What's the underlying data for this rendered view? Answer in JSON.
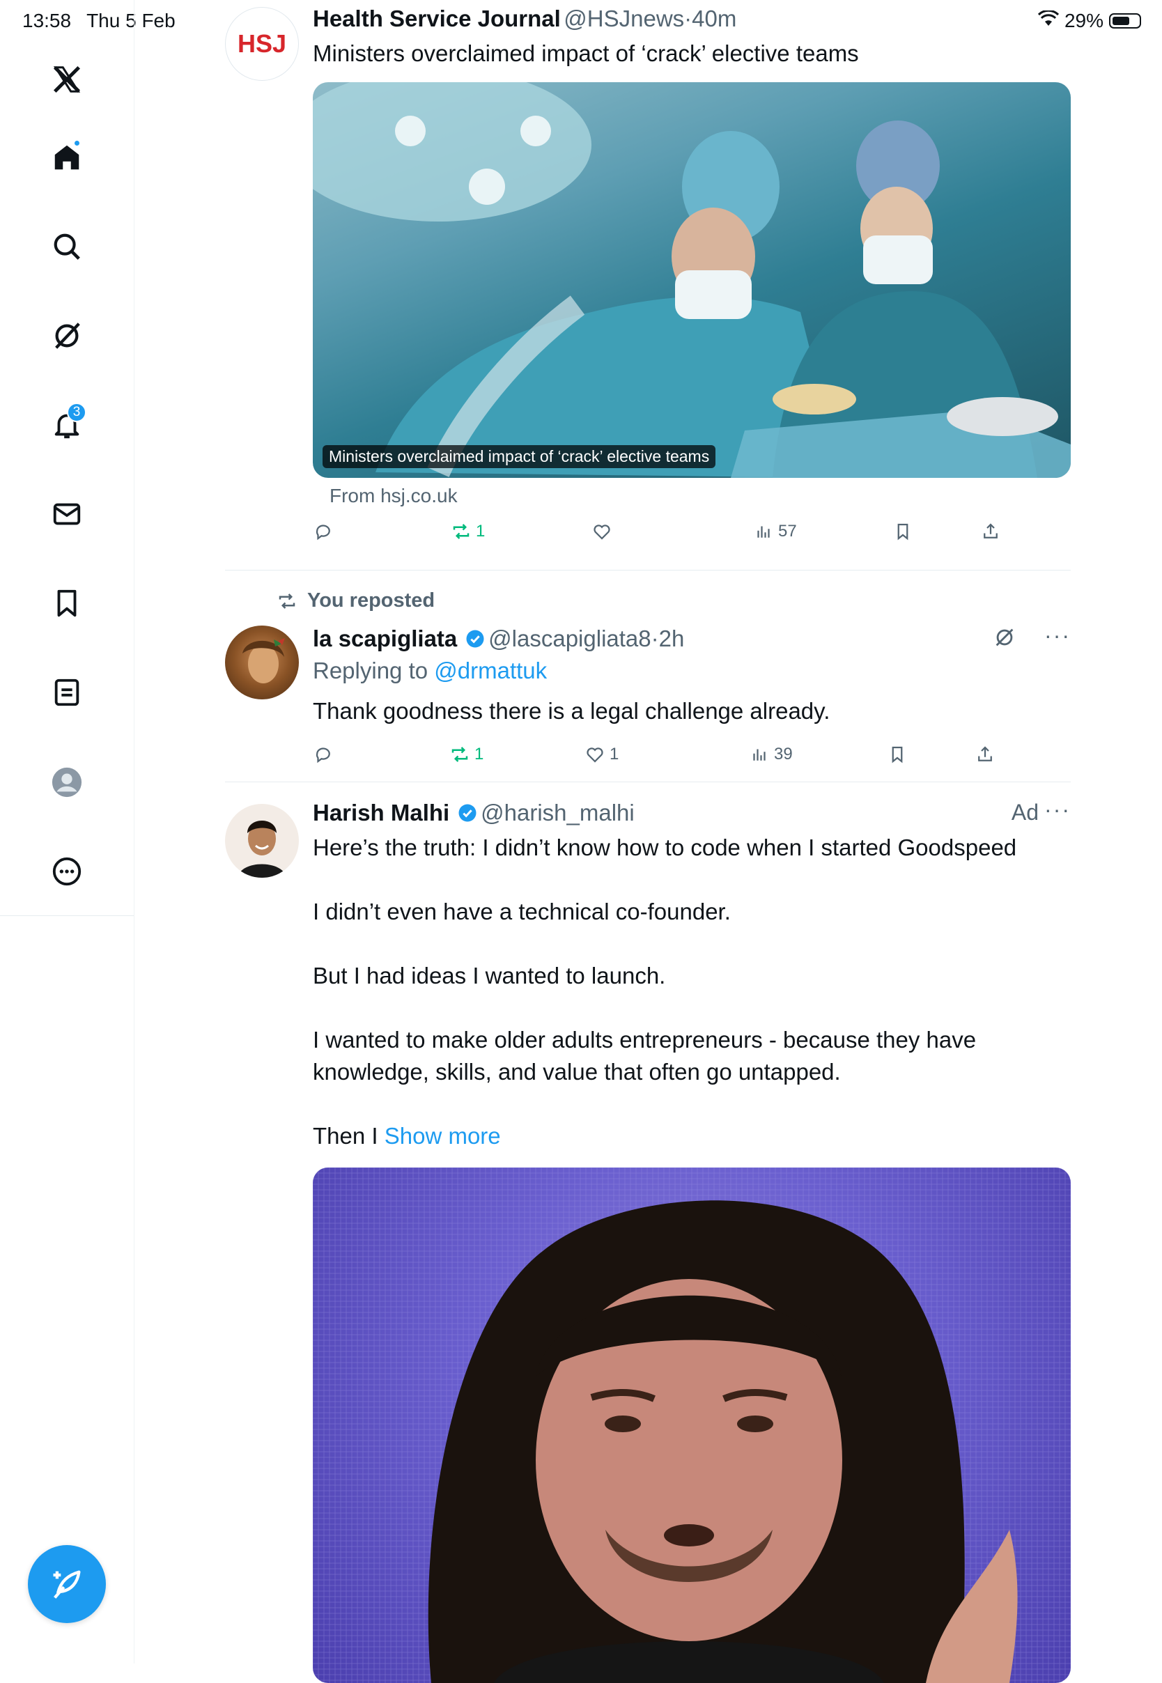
{
  "status_bar": {
    "time": "13:58",
    "date": "Thu 5 Feb",
    "battery": "29%"
  },
  "sidebar": {
    "notifications_count": "3"
  },
  "posts": [
    {
      "author": "Health Service Journal",
      "handle": "@HSJnews",
      "time": "40m",
      "avatar_text": "HSJ",
      "text": "Ministers overclaimed impact of ‘crack’ elective teams",
      "card_caption": "Ministers overclaimed impact of ‘crack’ elective teams",
      "card_source": "From hsj.co.uk",
      "reposts": "1",
      "views": "57"
    },
    {
      "context": "You reposted",
      "author": "la scapigliata",
      "handle": "@lascapigliata8",
      "time": "2h",
      "replying_prefix": "Replying to",
      "replying_to": "@drmattuk",
      "text": "Thank goodness there is a legal challenge already.",
      "reposts": "1",
      "likes": "1",
      "views": "39"
    },
    {
      "author": "Harish Malhi",
      "handle": "@harish_malhi",
      "ad_label": "Ad",
      "paragraphs": [
        "Here’s the truth: I didn’t know how to code when I started Goodspeed",
        "I didn’t even have a technical co-founder.",
        "But I had ideas I wanted to launch.",
        "I wanted to make older adults entrepreneurs - because they have knowledge, skills, and value that often go untapped."
      ],
      "truncated_text": "Then I",
      "show_more": "Show more"
    }
  ],
  "colors": {
    "accent": "#1d9bf0",
    "repost_green": "#00ba7c",
    "muted": "#536471",
    "hsj_red": "#d7262b"
  }
}
